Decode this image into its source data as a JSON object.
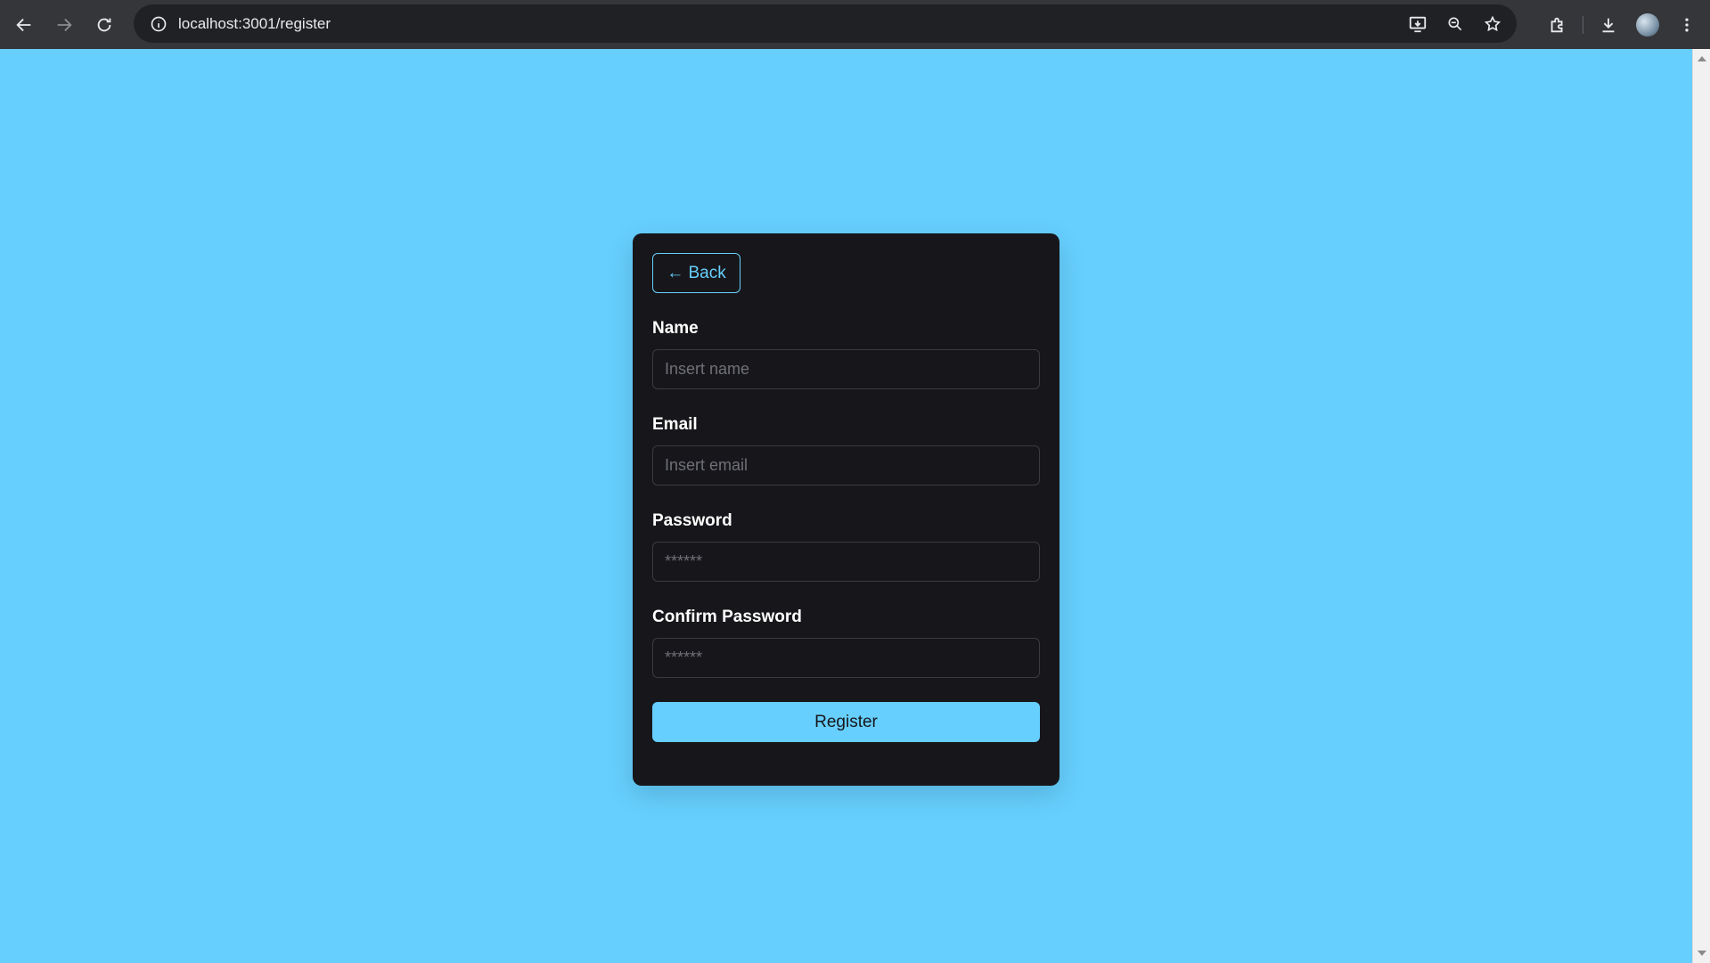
{
  "browser": {
    "url": "localhost:3001/register",
    "icons": [
      "back-icon",
      "forward-icon",
      "reload-icon",
      "site-info-icon",
      "install-app-icon",
      "zoom-icon",
      "bookmark-star-icon",
      "extensions-icon",
      "downloads-icon",
      "profile-avatar",
      "menu-icon"
    ]
  },
  "form": {
    "back_label": "← Back",
    "name_label": "Name",
    "name_placeholder": "Insert name",
    "email_label": "Email",
    "email_placeholder": "Insert email",
    "password_label": "Password",
    "password_placeholder": "******",
    "confirm_label": "Confirm Password",
    "confirm_placeholder": "******",
    "register_label": "Register"
  },
  "colors": {
    "page_background": "#66cffe",
    "card_background": "#17171b",
    "accent": "#66cffe"
  }
}
